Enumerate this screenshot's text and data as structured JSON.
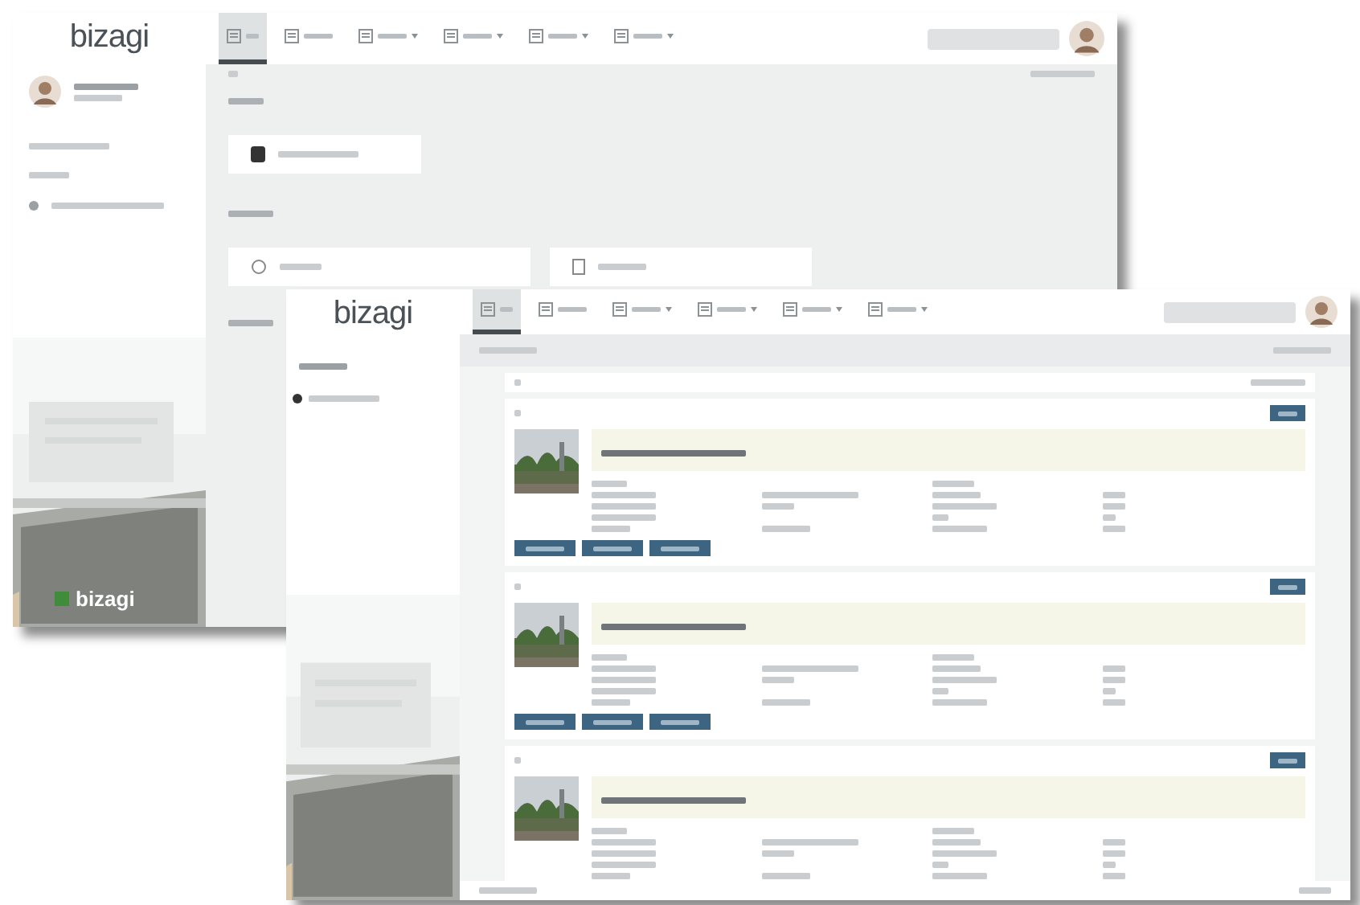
{
  "windows": [
    {
      "kind": "home",
      "logo": "bizagi",
      "picture_logo": "bizagi",
      "tabs": [
        {
          "selected": true
        },
        {
          "selected": false
        },
        {
          "selected": false
        },
        {
          "selected": false
        },
        {
          "selected": false
        },
        {
          "selected": false
        }
      ]
    },
    {
      "kind": "list",
      "logo": "bizagi",
      "tabs": [
        {
          "selected": true
        },
        {
          "selected": false
        },
        {
          "selected": false
        },
        {
          "selected": false
        },
        {
          "selected": false
        },
        {
          "selected": false
        }
      ],
      "cases": [
        {
          "has_actions": true
        },
        {
          "has_actions": true
        },
        {
          "has_actions": false
        }
      ]
    }
  ]
}
